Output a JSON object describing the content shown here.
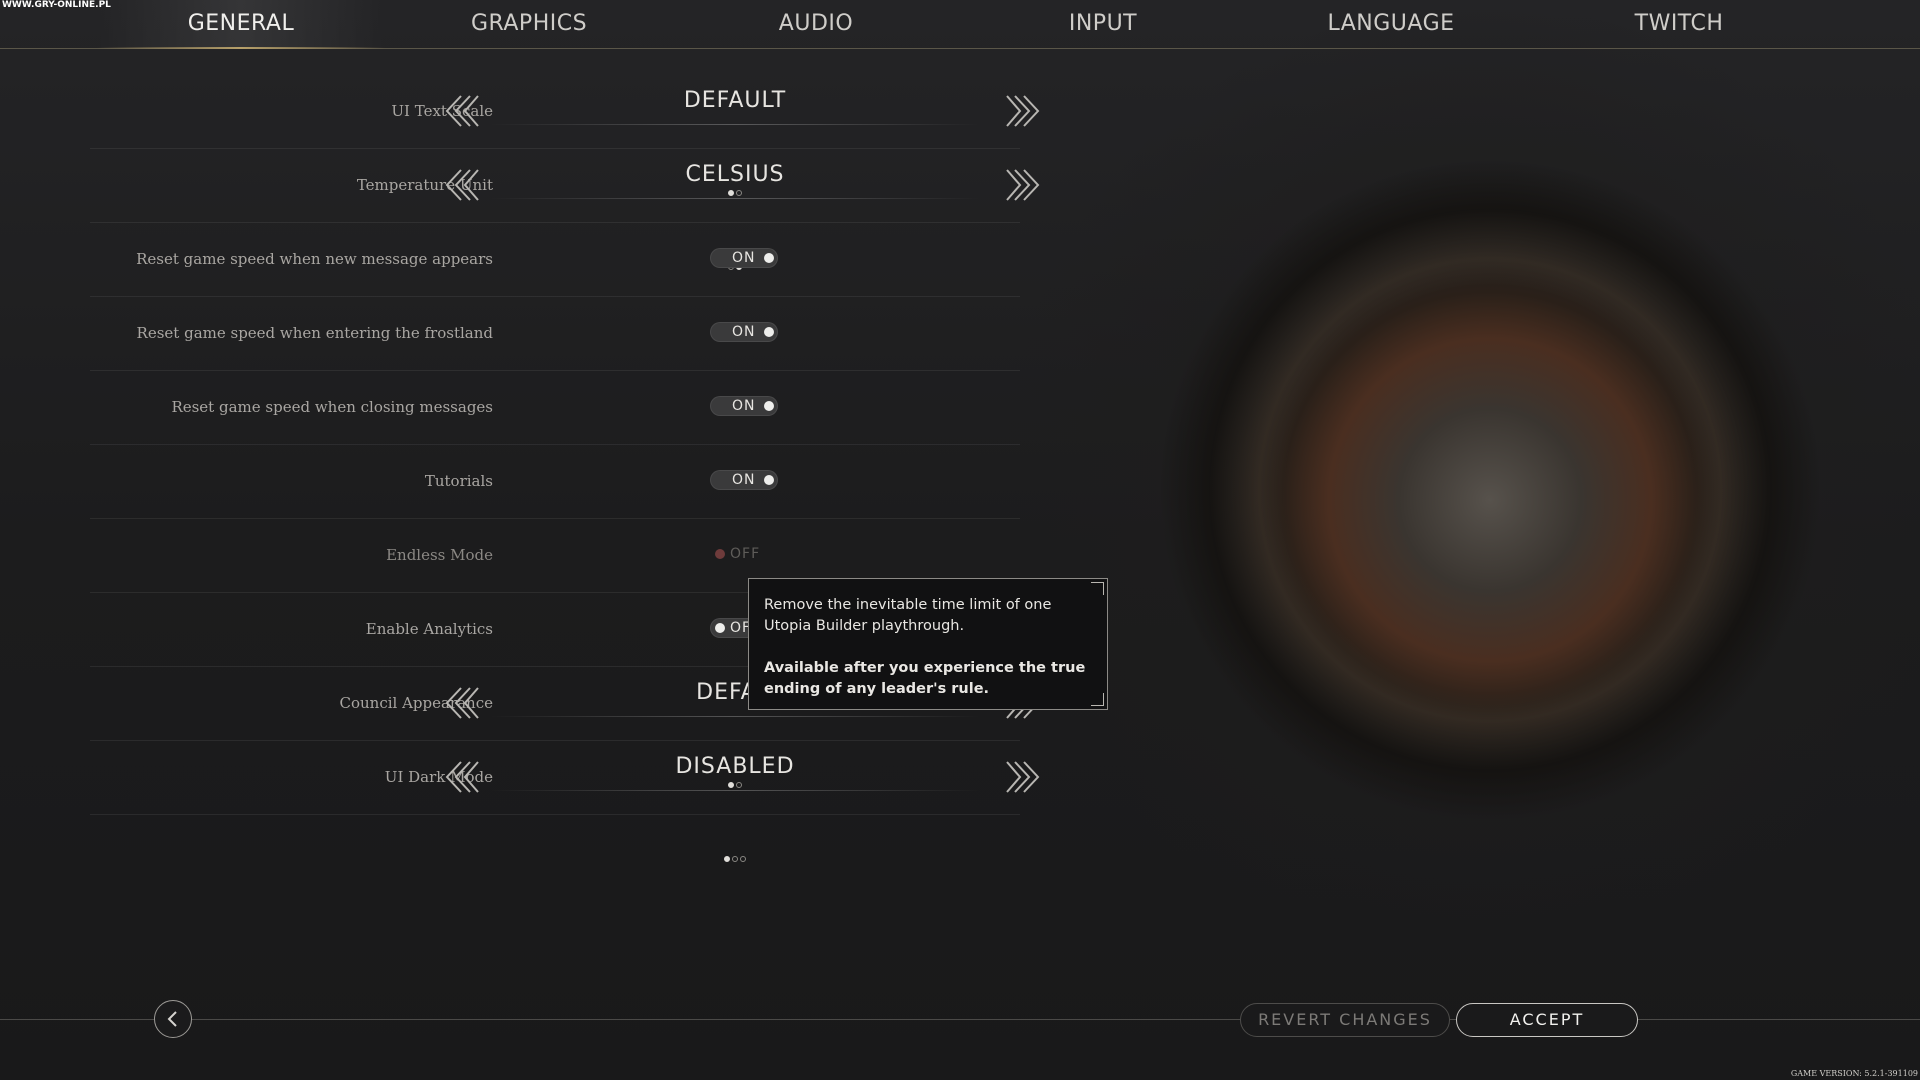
{
  "watermark": "WWW.GRY-ONLINE.PL",
  "tabs": [
    {
      "label": "GENERAL"
    },
    {
      "label": "GRAPHICS"
    },
    {
      "label": "AUDIO"
    },
    {
      "label": "INPUT"
    },
    {
      "label": "LANGUAGE"
    },
    {
      "label": "TWITCH"
    }
  ],
  "settings": {
    "ui_text_scale": {
      "label": "UI Text Scale",
      "value": "DEFAULT",
      "option_index": 1,
      "option_count": 2
    },
    "temperature_unit": {
      "label": "Temperature Unit",
      "value": "CELSIUS",
      "option_index": 2,
      "option_count": 2
    },
    "reset_new_message": {
      "label": "Reset game speed when new message appears",
      "value": "ON"
    },
    "reset_frostland": {
      "label": "Reset game speed when entering the frostland",
      "value": "ON"
    },
    "reset_closing": {
      "label": "Reset game speed when closing messages",
      "value": "ON"
    },
    "tutorials": {
      "label": "Tutorials",
      "value": "ON"
    },
    "endless_mode": {
      "label": "Endless Mode",
      "value": "OFF"
    },
    "enable_analytics": {
      "label": "Enable Analytics",
      "value": "OF"
    },
    "council_appearance": {
      "label": "Council Appearance",
      "value": "DEFAU",
      "option_index": 1,
      "option_count": 2
    },
    "ui_dark_mode": {
      "label": "UI Dark Mode",
      "value": "DISABLED",
      "option_index": 1,
      "option_count": 3
    }
  },
  "tooltip": {
    "line1": "Remove the inevitable time limit of one Utopia Builder playthrough.",
    "line2": "Available after you experience the true ending of any leader's rule."
  },
  "buttons": {
    "revert": "REVERT CHANGES",
    "accept": "ACCEPT"
  },
  "version": "GAME VERSION: 5.2.1-391109",
  "colors": {
    "background": "#1b1b1c",
    "tab_accent": "#b7a06a",
    "disabled_knob": "#6e3b3b"
  }
}
